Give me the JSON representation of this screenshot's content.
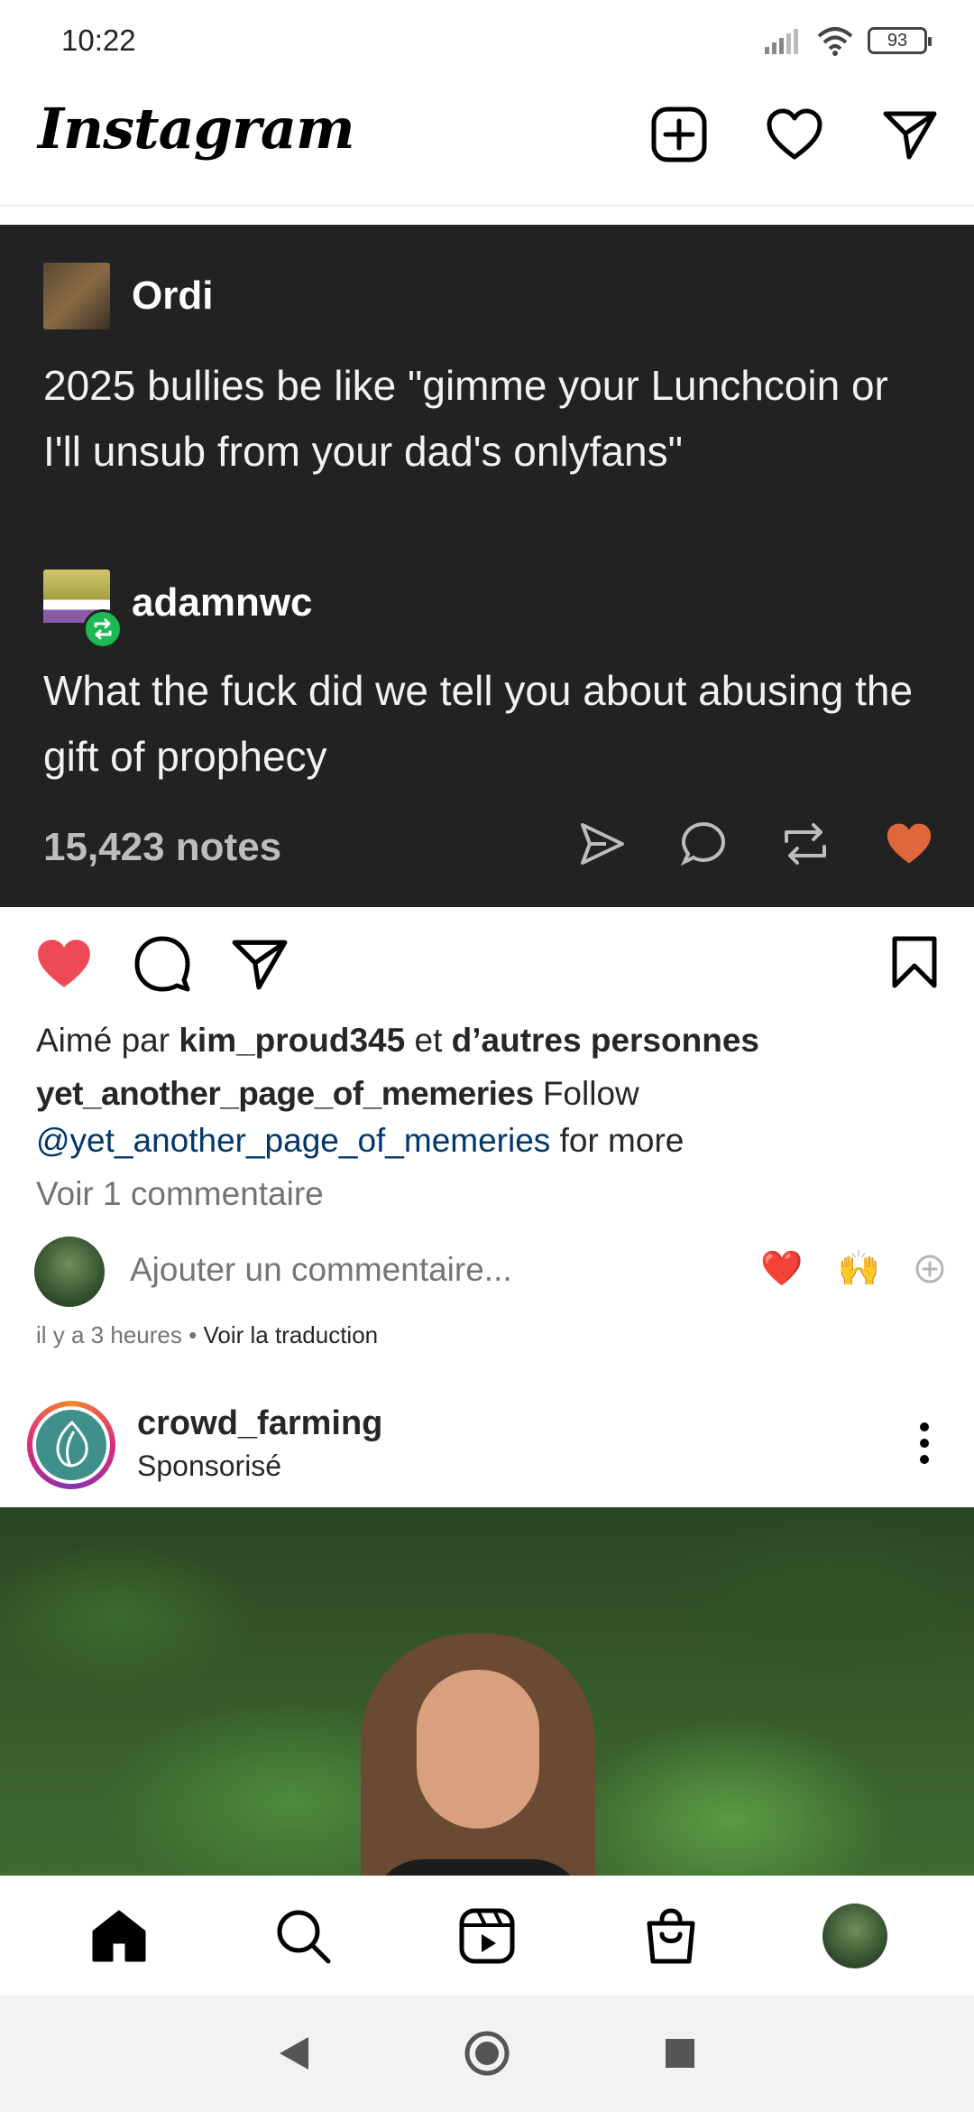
{
  "status_bar": {
    "time": "10:22",
    "battery": "93"
  },
  "header": {
    "logo": "Instagram"
  },
  "tumblr_post": {
    "op_name": "Ordi",
    "op_text": "2025 bullies be like \"gimme your Lunchcoin or I'll unsub from your dad's onlyfans\"",
    "reply_name": "adamnwc",
    "reply_text": "What the fuck did we tell you about abusing the gift of prophecy",
    "notes": "15,423 notes"
  },
  "post": {
    "likes_prefix": "Aimé par",
    "likes_user": "kim_proud345",
    "likes_middle": "et",
    "likes_others": "d’autres personnes",
    "caption_author": "yet_another_page_of_memeries",
    "caption_text": "Follow",
    "caption_mention": "@yet_another_page_of_memeries",
    "caption_suffix": "for more",
    "view_comments": "Voir 1 commentaire",
    "comment_placeholder": "Ajouter un commentaire...",
    "quick_react_1": "❤️",
    "quick_react_2": "🙌",
    "time_ago": "il y a 3 heures",
    "separator": "•",
    "translate": "Voir la traduction"
  },
  "sponsored": {
    "username": "crowd_farming",
    "label": "Sponsorisé"
  },
  "colors": {
    "like_red": "#ed4956",
    "tumblr_heart": "#e0663c",
    "mention_blue": "#00376b",
    "tumblr_bg": "#222222"
  }
}
